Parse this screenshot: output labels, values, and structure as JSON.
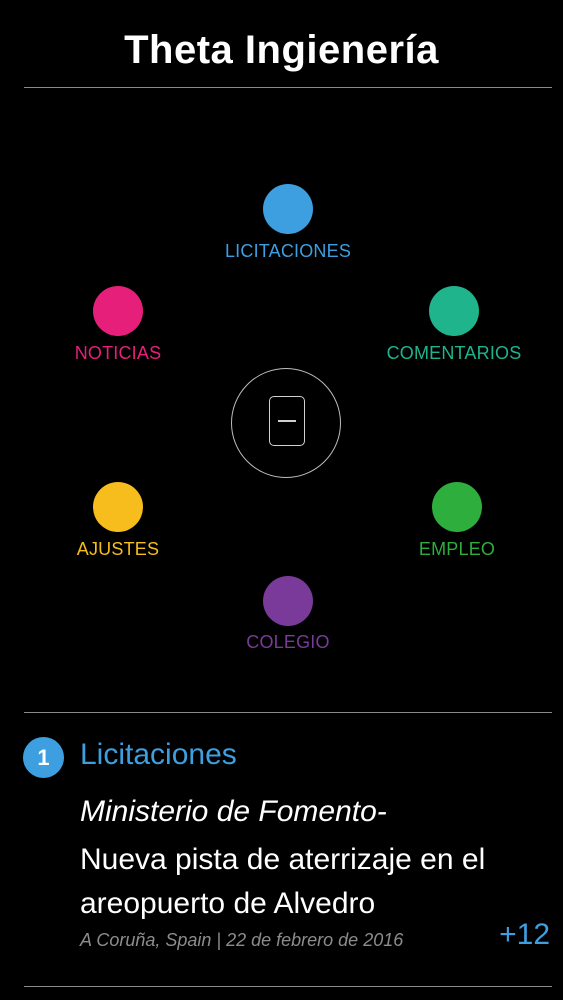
{
  "header": {
    "title": "Theta Ingienería"
  },
  "menu": {
    "licitaciones": {
      "label": "LICITACIONES",
      "color": "#3d9ee0"
    },
    "noticias": {
      "label": "NOTICIAS",
      "color": "#e6207a"
    },
    "comentarios": {
      "label": "COMENTARIOS",
      "color": "#1fb48c"
    },
    "ajustes": {
      "label": "AJUSTES",
      "color": "#f6bd1d"
    },
    "empleo": {
      "label": "EMPLEO",
      "color": "#2eae3c"
    },
    "colegio": {
      "label": "COLEGIO",
      "color": "#7a3a9a"
    }
  },
  "center": {
    "icon": "tablet-icon"
  },
  "feed": {
    "badge": "1",
    "section": "Licitaciones",
    "source": "Ministerio de Fomento-",
    "title": "Nueva pista de aterrizaje en el areopuerto de Alvedro",
    "meta": "A Coruña, Spain | 22 de febrero de 2016",
    "more": "+12"
  }
}
